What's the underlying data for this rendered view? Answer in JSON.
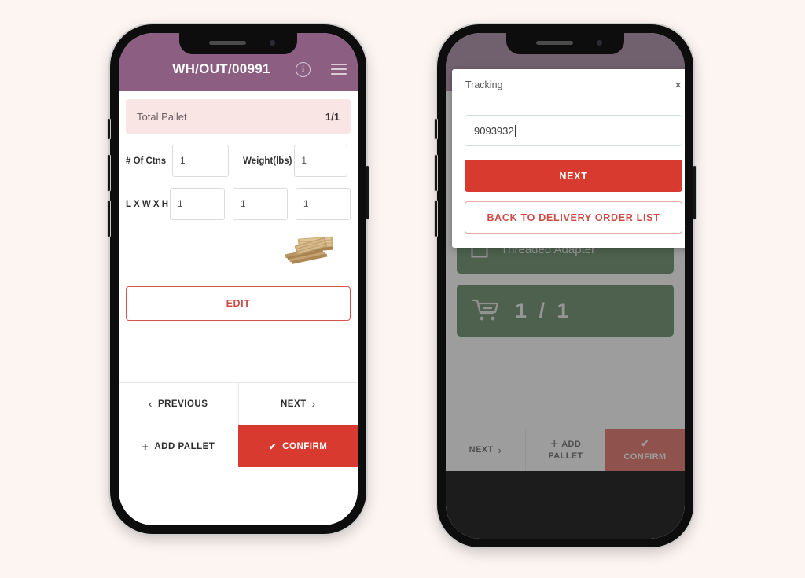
{
  "theme": {
    "background": "#fdf5f2",
    "header_purple": "#8c5f82",
    "banner_pink": "#f9e5e3",
    "accent_red": "#d93a2f",
    "outline_red": "#cd4b46",
    "green": "#2e6130"
  },
  "phone1": {
    "header": {
      "back_icon": "chevron-left-icon",
      "title": "WH/OUT/00991",
      "info_icon": "i",
      "menu_icon": "hamburger-icon"
    },
    "banner": {
      "label": "Total Pallet",
      "value": "1/1"
    },
    "form": {
      "ctns_label": "# Of Ctns",
      "ctns_value": "1",
      "weight_label": "Weight(lbs)",
      "weight_value": "1",
      "lwh_label": "L X W X H",
      "length_value": "1",
      "width_value": "1",
      "height_value": "1"
    },
    "pallet_image_alt": "wooden-pallets",
    "edit_label": "EDIT",
    "nav": {
      "previous_label": "PREVIOUS",
      "previous_chevron": "‹",
      "next_label": "NEXT",
      "next_chevron": "›",
      "add_pallet_label": "ADD PALLET",
      "add_pallet_icon": "+",
      "confirm_label": "CONFIRM",
      "confirm_icon": "✔"
    }
  },
  "phone2": {
    "modal": {
      "title": "Tracking",
      "close_icon": "×",
      "input_value": "9093932",
      "input_placeholder": "",
      "next_label": "NEXT",
      "back_label": "BACK TO DELIVERY ORDER LIST"
    },
    "cards": [
      {
        "icon": "box-icon",
        "label": "Threaded Adapter"
      },
      {
        "icon": "cart-icon",
        "label": "1 / 1"
      }
    ],
    "bottom": {
      "next_label": "NEXT",
      "next_chevron": "›",
      "add_pallet_line1": "＋ ADD",
      "add_pallet_line2": "PALLET",
      "confirm_icon": "✔",
      "confirm_label": "CONFIRM"
    }
  }
}
